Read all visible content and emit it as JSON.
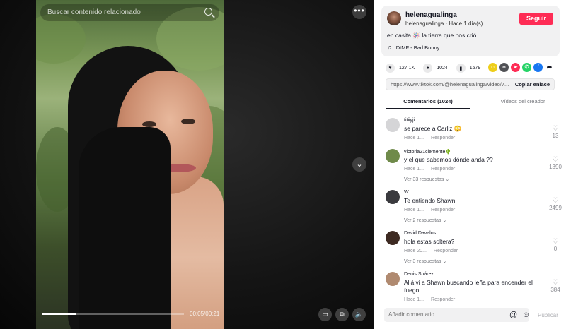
{
  "video": {
    "search_placeholder": "Buscar contenido relacionado",
    "time": "00:05/00:21",
    "progress": 0.24,
    "more_glyph": "•••",
    "next_glyph": "⌄"
  },
  "author": {
    "username": "helenagualinga",
    "subline": "helenagualinga · Hace 1 día(s)",
    "follow_label": "Seguir",
    "caption": "en casita 🪅 la tierra que nos crió",
    "music": "DtMF - Bad Bunny"
  },
  "stats": {
    "likes": "127.1K",
    "comments": "1024",
    "saves": "1679"
  },
  "share": {
    "link": "https://www.tiktok.com/@helenagualinga/video/7...",
    "copy_label": "Copiar enlace",
    "colors": {
      "embed": "#eece1a",
      "code": "#505155",
      "send": "#fe2c55",
      "whatsapp": "#25d366",
      "facebook": "#1877f2"
    }
  },
  "tabs": {
    "comments": "Comentarios (1024)",
    "creator_videos": "Vídeos del creador"
  },
  "comments": [
    {
      "user": "titiiyji",
      "text": "se parece a Carliz 😳",
      "time": "Hace 1...",
      "reply": "Responder",
      "likes": "13",
      "replies": ""
    },
    {
      "user": "victoria21clemente🌵",
      "text": "y el que sabemos dónde anda ??",
      "time": "Hace 1...",
      "reply": "Responder",
      "likes": "1390",
      "replies": "Ver 33 respuestas ⌄"
    },
    {
      "user": "W",
      "text": "Te entiendo Shawn",
      "time": "Hace 1...",
      "reply": "Responder",
      "likes": "2499",
      "replies": "Ver 2 respuestas ⌄"
    },
    {
      "user": "David Davalos",
      "text": "hola estas soltera?",
      "time": "Hace 20...",
      "reply": "Responder",
      "likes": "0",
      "replies": "Ver 3 respuestas ⌄"
    },
    {
      "user": "Denis Suárez",
      "text": "Allá vi a Shawn buscando leña para encender el fuego",
      "time": "Hace 1...",
      "reply": "Responder",
      "likes": "384",
      "replies": ""
    }
  ],
  "footer": {
    "placeholder": "Añadir comentario...",
    "publish_label": "Publicar"
  }
}
